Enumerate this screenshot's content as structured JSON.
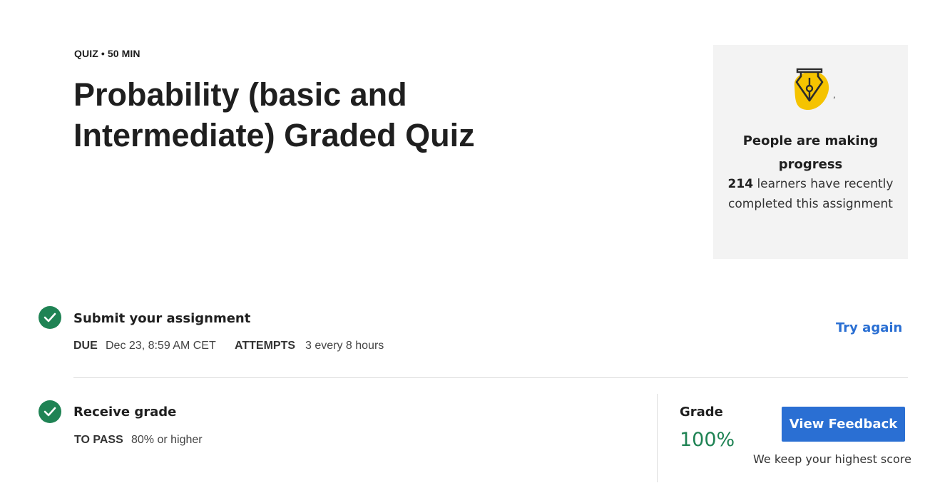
{
  "header": {
    "kicker": "QUIZ • 50 MIN",
    "title": "Probability (basic and Intermediate) Graded Quiz"
  },
  "progress_card": {
    "icon": "fountain-pen-icon",
    "comma": ",",
    "heading": "People are making progress",
    "count": "214",
    "text": "learners have recently completed this assignment"
  },
  "submit_step": {
    "icon": "check-circle-icon",
    "title": "Submit your assignment",
    "due_label": "DUE",
    "due_value": "Dec 23, 8:59 AM CET",
    "attempts_label": "ATTEMPTS",
    "attempts_value": "3 every 8 hours",
    "try_again": "Try again"
  },
  "grade_step": {
    "icon": "check-circle-icon",
    "title": "Receive grade",
    "to_pass_label": "TO PASS",
    "to_pass_value": "80% or higher",
    "grade_label": "Grade",
    "grade_value": "100%",
    "feedback_button": "View Feedback",
    "note": "We keep your highest score"
  },
  "colors": {
    "accent_blue": "#2a6fd3",
    "success_green": "#1f8354",
    "card_bg": "#f3f3f3",
    "icon_yellow": "#f5c300"
  }
}
